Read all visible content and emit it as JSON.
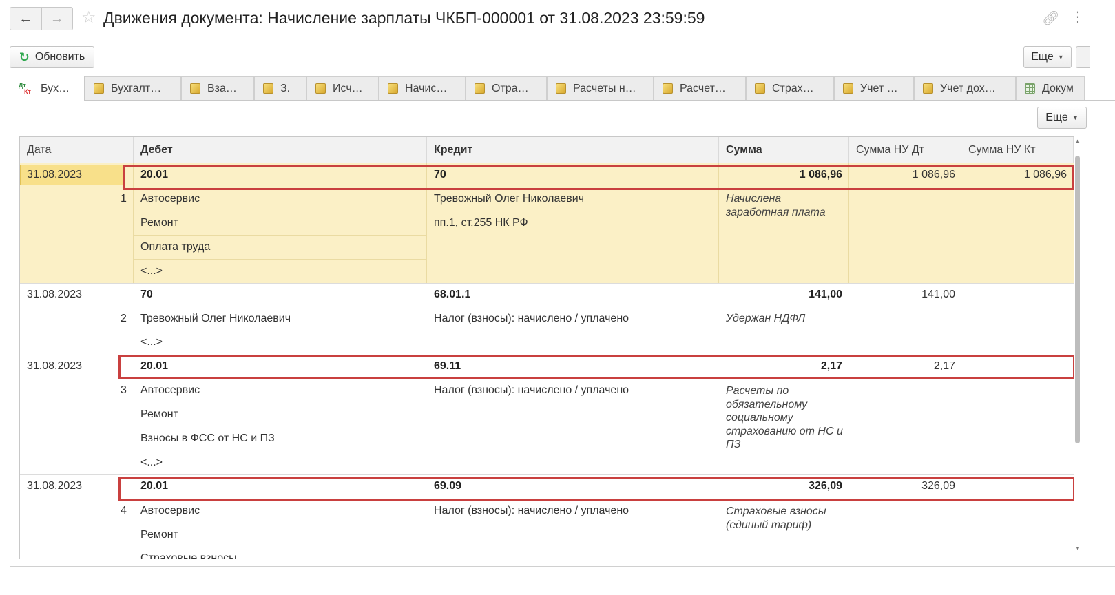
{
  "window": {
    "title": "Движения документа: Начисление зарплаты ЧКБП-000001 от 31.08.2023 23:59:59",
    "back_icon": "arrow-left-icon",
    "forward_icon": "arrow-right-icon"
  },
  "toolbar": {
    "refresh_label": "Обновить",
    "more_label": "Еще"
  },
  "tabs": [
    {
      "label": "Бух…",
      "icon": "dt-kt-icon",
      "active": true
    },
    {
      "label": "Бухгалт…",
      "icon": "register-icon"
    },
    {
      "label": "Вза…",
      "icon": "register-icon"
    },
    {
      "label": "З.",
      "icon": "register-icon"
    },
    {
      "label": "Исч…",
      "icon": "register-icon"
    },
    {
      "label": "Начис…",
      "icon": "register-icon"
    },
    {
      "label": "Отра…",
      "icon": "register-icon"
    },
    {
      "label": "Расчеты н…",
      "icon": "register-icon"
    },
    {
      "label": "Расчет…",
      "icon": "register-icon"
    },
    {
      "label": "Страх…",
      "icon": "register-icon"
    },
    {
      "label": "Учет …",
      "icon": "register-icon"
    },
    {
      "label": "Учет дох…",
      "icon": "register-icon"
    },
    {
      "label": "Докум",
      "icon": "table-icon"
    }
  ],
  "panel": {
    "more_label": "Еще"
  },
  "columns": {
    "date": "Дата",
    "debit": "Дебет",
    "credit": "Кредит",
    "sum": "Сумма",
    "sum_nu_dt": "Сумма НУ Дт",
    "sum_nu_kt": "Сумма НУ Кт"
  },
  "rows": [
    {
      "date": "31.08.2023",
      "num": "1",
      "debit_account": "20.01",
      "debit_sub": [
        "Автосервис",
        "Ремонт",
        "Оплата труда",
        "<...>"
      ],
      "credit_account": "70",
      "credit_sub": [
        "Тревожный Олег Николаевич",
        "пп.1, ст.255 НК РФ"
      ],
      "sum": "1 086,96",
      "content": "Начислена заработная плата",
      "sum_nu_dt": "1 086,96",
      "sum_nu_kt": "1 086,96"
    },
    {
      "date": "31.08.2023",
      "num": "2",
      "debit_account": "70",
      "debit_sub": [
        "Тревожный Олег Николаевич",
        "<...>"
      ],
      "credit_account": "68.01.1",
      "credit_sub": [
        "Налог (взносы): начислено / уплачено"
      ],
      "sum": "141,00",
      "content": "Удержан НДФЛ",
      "sum_nu_dt": "141,00",
      "sum_nu_kt": ""
    },
    {
      "date": "31.08.2023",
      "num": "3",
      "debit_account": "20.01",
      "debit_sub": [
        "Автосервис",
        "Ремонт",
        "Взносы в ФСС от НС и ПЗ",
        "<...>"
      ],
      "credit_account": "69.11",
      "credit_sub": [
        "Налог (взносы): начислено / уплачено"
      ],
      "sum": "2,17",
      "content": "Расчеты по обязательному социальному страхованию от НС и ПЗ",
      "sum_nu_dt": "2,17",
      "sum_nu_kt": ""
    },
    {
      "date": "31.08.2023",
      "num": "4",
      "debit_account": "20.01",
      "debit_sub": [
        "Автосервис",
        "Ремонт",
        "Страховые взносы"
      ],
      "credit_account": "69.09",
      "credit_sub": [
        "Налог (взносы): начислено / уплачено"
      ],
      "sum": "326,09",
      "content": "Страховые взносы (единый тариф)",
      "sum_nu_dt": "326,09",
      "sum_nu_kt": ""
    }
  ],
  "colors": {
    "highlight": "#fbf0c6",
    "annotation": "#c9403f",
    "refresh_icon": "#2fa84f"
  }
}
